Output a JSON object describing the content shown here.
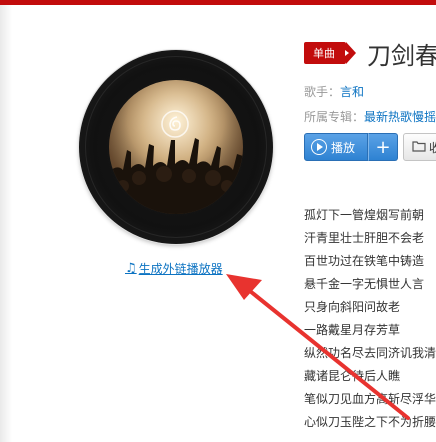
{
  "badge": {
    "label": "单曲",
    "color": "#c20c0c"
  },
  "song": {
    "title": "刀剑春"
  },
  "meta": {
    "singer_label": "歌手：",
    "singer": "言和",
    "album_label": "所属专辑：",
    "album": "最新热歌慢摇"
  },
  "buttons": {
    "play_label": "播放",
    "add_label": "+",
    "fav_label": "收"
  },
  "link": {
    "external_player": "生成外链播放器"
  },
  "lyrics": [
    "孤灯下一管煌烟写前朝",
    "汗青里壮士肝胆不会老",
    "百世功过在铁笔中铸造",
    "悬千金一字无惧世人言",
    "只身向斜阳问故老",
    "一路戴星月存芳草",
    "纵然功名尽去同济讥我清",
    "藏诸昆仑待后人瞧",
    "笔似刀见血方高斩尽浮华",
    "心似刀玉陛之下不为折腰"
  ],
  "annotation": {
    "arrow_color": "#e8332f"
  }
}
